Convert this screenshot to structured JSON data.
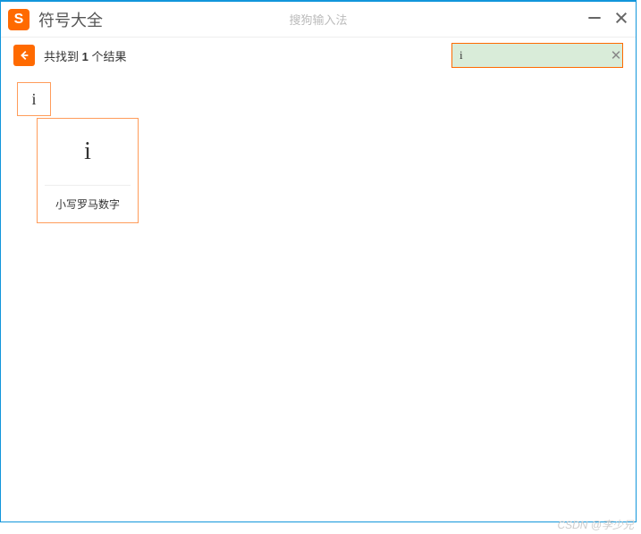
{
  "titlebar": {
    "icon_letter": "S",
    "title": "符号大全",
    "subtitle": "搜狗输入法"
  },
  "toolbar": {
    "results_prefix": "共找到 ",
    "results_count": "1",
    "results_suffix": " 个结果"
  },
  "search": {
    "value": "i"
  },
  "results": [
    {
      "symbol": "i",
      "label": "小写罗马数字"
    }
  ],
  "watermark": "CSDN @李少兄"
}
